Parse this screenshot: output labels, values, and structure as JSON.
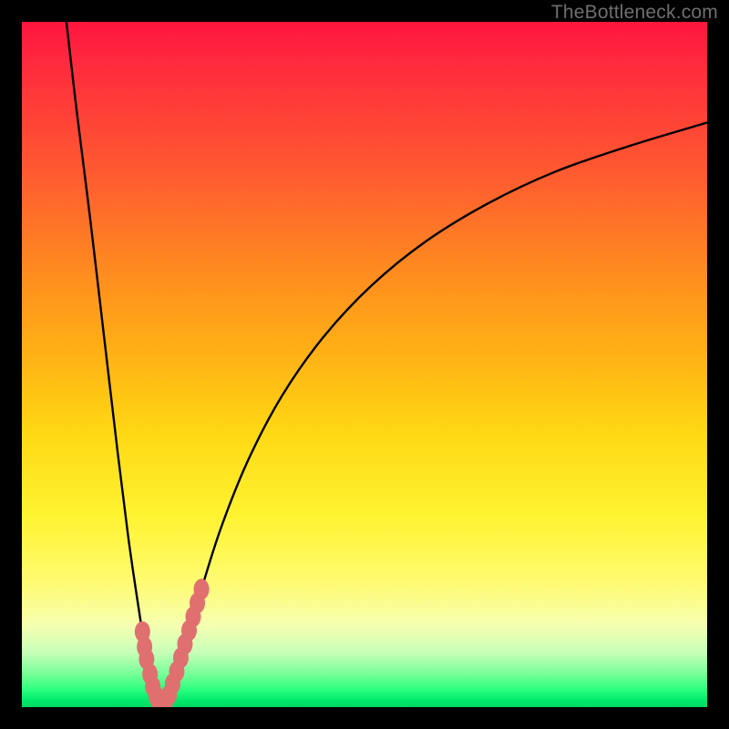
{
  "watermark": "TheBottleneck.com",
  "colors": {
    "frame": "#000000",
    "curve": "#000000",
    "marker_fill": "#e07070",
    "marker_stroke": "#c45a5a",
    "gradient_top": "#ff163e",
    "gradient_bottom": "#00d862"
  },
  "chart_data": {
    "type": "line",
    "title": "",
    "xlabel": "",
    "ylabel": "",
    "xlim": [
      0,
      100
    ],
    "ylim": [
      0,
      100
    ],
    "note": "Two-branch bottleneck curve (percentage mismatch vs. relative component strength). Values estimated from pixel positions; the chart has no numeric axis labels.",
    "series": [
      {
        "name": "left-branch",
        "x": [
          6.5,
          8,
          10,
          12,
          14,
          15.5,
          16.8,
          17.8,
          18.6,
          19.2,
          19.7,
          20.1,
          20.4
        ],
        "y": [
          100,
          87,
          71,
          54,
          37,
          25,
          16,
          9.5,
          5,
          2.4,
          1.0,
          0.25,
          0
        ]
      },
      {
        "name": "right-branch",
        "x": [
          20.4,
          20.9,
          21.6,
          22.6,
          24.0,
          26.0,
          29.0,
          33.0,
          38.0,
          44.0,
          51.0,
          59.0,
          68.0,
          78.0,
          89.0,
          100.0
        ],
        "y": [
          0,
          0.7,
          2.2,
          5.0,
          9.5,
          16.5,
          26.0,
          36.0,
          45.5,
          54.0,
          61.5,
          68.0,
          73.5,
          78.2,
          82.0,
          85.3
        ]
      }
    ],
    "markers": {
      "name": "sample-points",
      "x": [
        17.6,
        17.9,
        18.2,
        18.7,
        19.1,
        19.6,
        20.0,
        20.4,
        20.9,
        21.5,
        22.0,
        22.6,
        23.2,
        23.8,
        24.4,
        25.0,
        25.6,
        26.2
      ],
      "y": [
        11.0,
        8.8,
        7.0,
        4.8,
        3.0,
        1.6,
        0.6,
        0.1,
        0.6,
        1.8,
        3.4,
        5.2,
        7.2,
        9.2,
        11.2,
        13.2,
        15.2,
        17.2
      ]
    }
  }
}
